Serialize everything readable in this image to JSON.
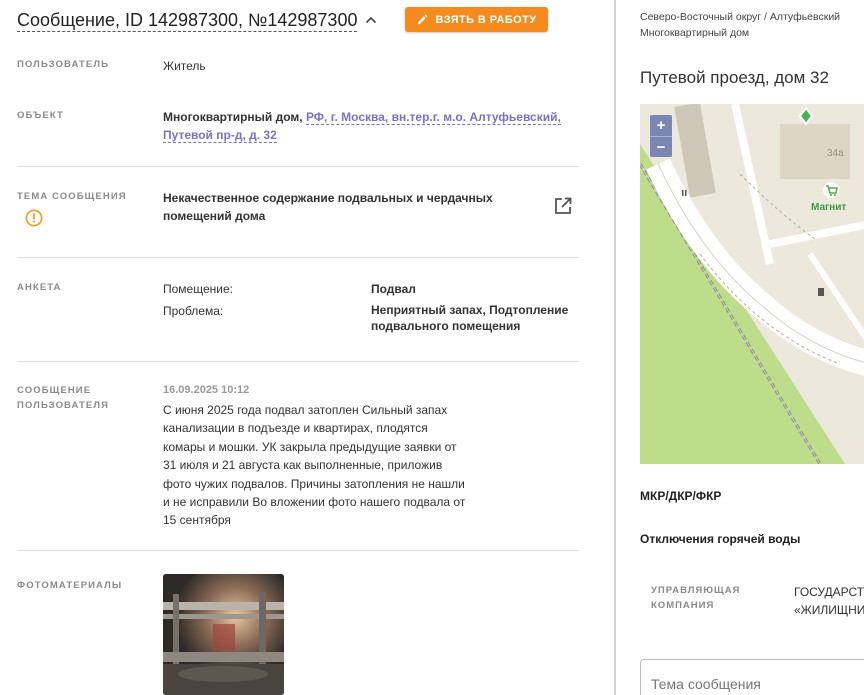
{
  "header": {
    "title": "Сообщение, ID 142987300, №142987300",
    "take_button": "ВЗЯТЬ В РАБОТУ"
  },
  "fields": {
    "user": {
      "label": "ПОЛЬЗОВАТЕЛЬ",
      "value": "Житель"
    },
    "object": {
      "label": "ОБЪЕКТ",
      "type": "Многоквартирный дом, ",
      "address_line1": "РФ, г. Москва, вн.тер.г. м.о. Алтуфьевский,",
      "address_line2": "Путевой пр-д, д. 32"
    },
    "topic": {
      "label": "ТЕМА СООБЩЕНИЯ",
      "line1": "Некачественное содержание подвальных и чердачных",
      "line2": "помещений дома"
    },
    "survey": {
      "label": "АНКЕТА",
      "rows": [
        {
          "key": "Помещение:",
          "value_line1": "Подвал",
          "value_line2": ""
        },
        {
          "key": "Проблема:",
          "value_line1": "Неприятный запах, Подтопление",
          "value_line2": "подвального помещения"
        }
      ]
    },
    "message": {
      "label_line1": "СООБЩЕНИЕ",
      "label_line2": "ПОЛЬЗОВАТЕЛЯ",
      "date": "16.09.2025 10:12",
      "text": "С июня 2025 года подвал затоплен Сильный запах канализации в подъезде и квартирах, плодятся комары и мошки. УК закрыла предыдущие заявки от 31 июля и 21 августа как выполненные, приложив фото чужих подвалов. Причины затопления не нашли и не исправили Во вложении фото нашего подвала от 15 сентября"
    },
    "photos": {
      "label": "ФОТОМАТЕРИАЛЫ"
    }
  },
  "right": {
    "breadcrumb_line1": "Северо-Восточный округ / Алтуфьевский",
    "breadcrumb_line2": "Многоквартирный дом",
    "address": "Путевой проезд, дом 32",
    "map": {
      "zoom_in": "+",
      "zoom_out": "−",
      "building_label": "34а",
      "shop_label": "Магнит"
    },
    "mkr_title": "МКР/ДКР/ФКР",
    "hot_water_title": "Отключения горячей воды",
    "company_label_line1": "УПРАВЛЯЮЩАЯ",
    "company_label_line2": "КОМПАНИЯ",
    "company_value_line1": "ГОСУДАРСТ",
    "company_value_line2": "«ЖИЛИЩНИ",
    "topic_input_placeholder": "Тема сообщения"
  },
  "colors": {
    "accent_orange": "#f58a1f",
    "link_purple": "#7e6fc6",
    "warning": "#f0a030",
    "zoom_control": "#7b86b3",
    "map_green": "#bedd8a"
  }
}
